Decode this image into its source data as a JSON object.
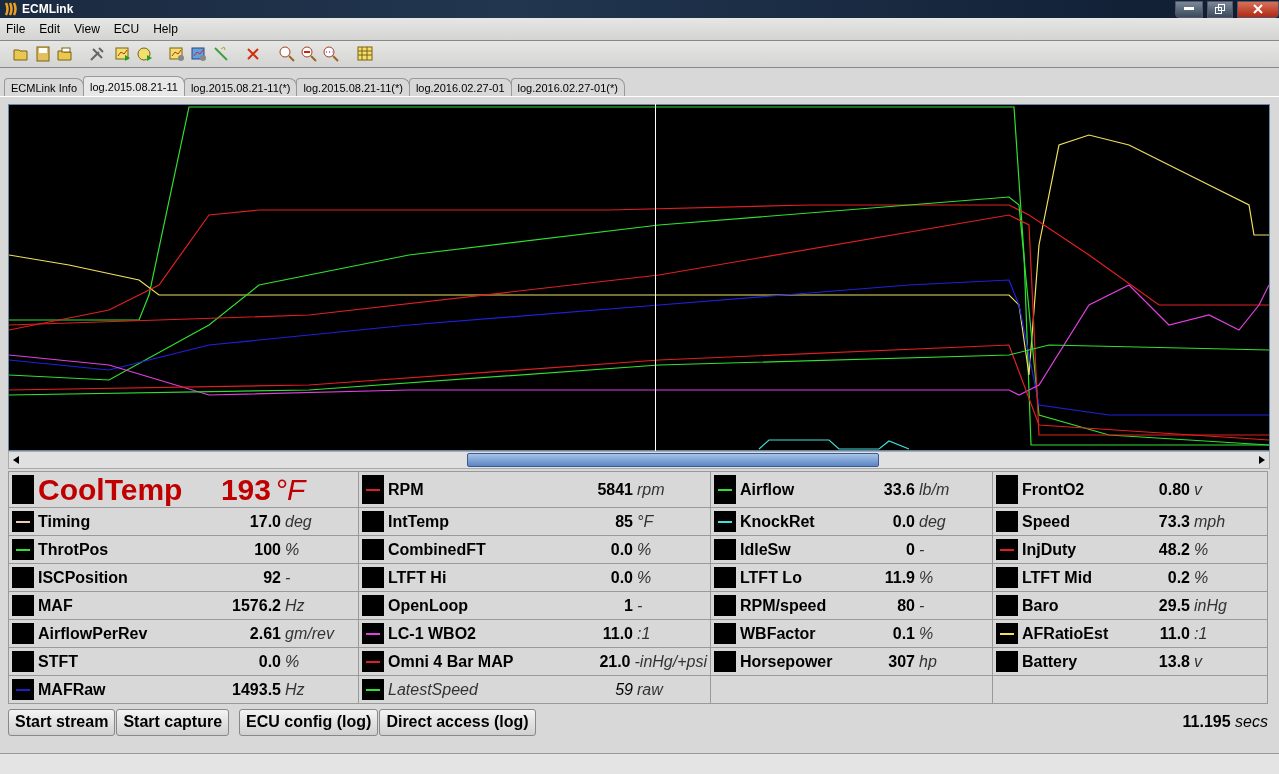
{
  "window": {
    "title": "ECMLink"
  },
  "menu": [
    "File",
    "Edit",
    "View",
    "ECU",
    "Help"
  ],
  "tabs": [
    {
      "label": "ECMLink Info",
      "selected": false
    },
    {
      "label": "log.2015.08.21-11",
      "selected": true
    },
    {
      "label": "log.2015.08.21-11(*)",
      "selected": false
    },
    {
      "label": "log.2015.08.21-11(*)",
      "selected": false
    },
    {
      "label": "log.2016.02.27-01",
      "selected": false
    },
    {
      "label": "log.2016.02.27-01(*)",
      "selected": false
    }
  ],
  "gauges": [
    [
      {
        "kind": "large",
        "name": "CoolTemp",
        "value": "193",
        "unit": "°F"
      },
      {
        "kind": "normal",
        "name": "Timing",
        "value": "17.0",
        "unit": "deg",
        "color": "#f0c8b0"
      },
      {
        "kind": "normal",
        "name": "ThrotPos",
        "value": "100",
        "unit": "%",
        "color": "#30e030"
      },
      {
        "kind": "normal",
        "name": "ISCPosition",
        "value": "92",
        "unit": "-"
      },
      {
        "kind": "normal",
        "name": "MAF",
        "value": "1576.2",
        "unit": "Hz"
      },
      {
        "kind": "normal",
        "name": "AirflowPerRev",
        "value": "2.61",
        "unit": "gm/rev"
      },
      {
        "kind": "normal",
        "name": "STFT",
        "value": "0.0",
        "unit": "%"
      },
      {
        "kind": "normal",
        "name": "MAFRaw",
        "value": "1493.5",
        "unit": "Hz",
        "color": "#2020c0"
      }
    ],
    [
      {
        "kind": "normal",
        "name": "RPM",
        "value": "5841",
        "unit": "rpm",
        "color": "#e02020"
      },
      {
        "kind": "normal",
        "name": "IntTemp",
        "value": "85",
        "unit": "°F"
      },
      {
        "kind": "normal",
        "name": "CombinedFT",
        "value": "0.0",
        "unit": "%"
      },
      {
        "kind": "normal",
        "name": "LTFT Hi",
        "value": "0.0",
        "unit": "%"
      },
      {
        "kind": "normal",
        "name": "OpenLoop",
        "value": "1",
        "unit": "-"
      },
      {
        "kind": "normal",
        "name": "LC-1 WBO2",
        "value": "11.0",
        "unit": ":1",
        "color": "#e040e0"
      },
      {
        "kind": "normal",
        "name": "Omni 4 Bar MAP",
        "value": "21.0",
        "unit": "-inHg/+psi",
        "color": "#e02020"
      },
      {
        "kind": "inactive",
        "name": "LatestSpeed",
        "value": "59",
        "unit": "raw",
        "color": "#30e030"
      }
    ],
    [
      {
        "kind": "normal",
        "name": "Airflow",
        "value": "33.6",
        "unit": "lb/m",
        "color": "#30e030"
      },
      {
        "kind": "normal",
        "name": "KnockRet",
        "value": "0.0",
        "unit": "deg",
        "color": "#40e0e0"
      },
      {
        "kind": "normal",
        "name": "IdleSw",
        "value": "0",
        "unit": "-"
      },
      {
        "kind": "normal",
        "name": "LTFT Lo",
        "value": "11.9",
        "unit": "%"
      },
      {
        "kind": "normal",
        "name": "RPM/speed",
        "value": "80",
        "unit": "-"
      },
      {
        "kind": "normal",
        "name": "WBFactor",
        "value": "0.1",
        "unit": "%"
      },
      {
        "kind": "normal",
        "name": "Horsepower",
        "value": "307",
        "unit": "hp"
      }
    ],
    [
      {
        "kind": "normal",
        "name": "FrontO2",
        "value": "0.80",
        "unit": "v"
      },
      {
        "kind": "normal",
        "name": "Speed",
        "value": "73.3",
        "unit": "mph"
      },
      {
        "kind": "normal",
        "name": "InjDuty",
        "value": "48.2",
        "unit": "%",
        "color": "#e02020"
      },
      {
        "kind": "normal",
        "name": "LTFT Mid",
        "value": "0.2",
        "unit": "%"
      },
      {
        "kind": "normal",
        "name": "Baro",
        "value": "29.5",
        "unit": "inHg"
      },
      {
        "kind": "normal",
        "name": "AFRatioEst",
        "value": "11.0",
        "unit": ":1",
        "color": "#f0e060"
      },
      {
        "kind": "normal",
        "name": "Battery",
        "value": "13.8",
        "unit": "v"
      }
    ]
  ],
  "button_groups": [
    [
      "Start stream",
      "Start capture"
    ],
    [
      "ECU config (log)",
      "Direct access (log)"
    ]
  ],
  "cursor_time": {
    "value": "11.195",
    "unit": "secs"
  }
}
